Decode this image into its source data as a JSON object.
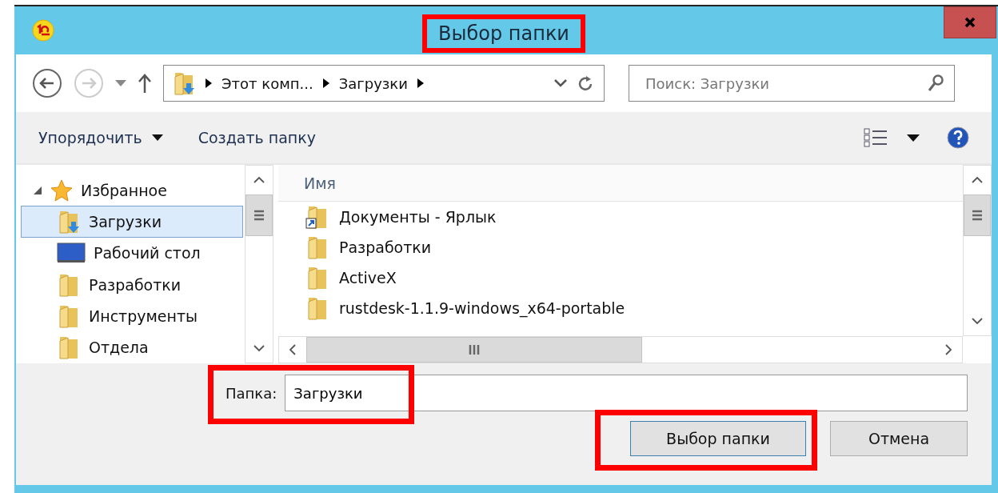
{
  "window": {
    "title": "Выбор папки",
    "title_highlighted": true
  },
  "address": {
    "crumbs": [
      "Этот комп...",
      "Загрузки"
    ]
  },
  "search": {
    "placeholder": "Поиск: Загрузки"
  },
  "toolbar": {
    "organize": "Упорядочить",
    "new_folder": "Создать папку"
  },
  "sidebar": {
    "group": {
      "label": "Избранное",
      "expanded": true
    },
    "items": [
      {
        "label": "Загрузки",
        "kind": "downloads",
        "selected": true
      },
      {
        "label": "Рабочий стол",
        "kind": "desktop",
        "selected": false
      },
      {
        "label": "Разработки",
        "kind": "folder",
        "selected": false
      },
      {
        "label": "Инструменты",
        "kind": "folder",
        "selected": false
      },
      {
        "label": "Отдела",
        "kind": "folder",
        "selected": false
      }
    ]
  },
  "files": {
    "columns": [
      "Имя"
    ],
    "rows": [
      {
        "name": "Документы - Ярлык",
        "kind": "shortcut"
      },
      {
        "name": "Разработки",
        "kind": "folder"
      },
      {
        "name": "ActiveX",
        "kind": "folder"
      },
      {
        "name": "rustdesk-1.1.9-windows_x64-portable",
        "kind": "folder"
      }
    ]
  },
  "folder_field": {
    "label": "Папка:",
    "value": "Загрузки",
    "highlighted": true
  },
  "buttons": [
    {
      "label": "Выбор папки",
      "primary": true,
      "highlighted": true
    },
    {
      "label": "Отмена",
      "primary": false,
      "highlighted": false
    }
  ]
}
